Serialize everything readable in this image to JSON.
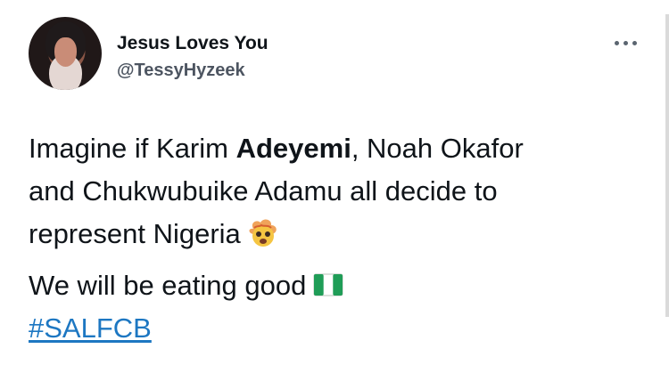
{
  "tweet": {
    "author": {
      "display_name": "Jesus Loves You",
      "handle": "@TessyHyzeek"
    },
    "body": {
      "line1_prefix": "Imagine if Karim ",
      "line1_bold": "Adeyemi",
      "line1_suffix": ", Noah Okafor",
      "line2": "and Chukwubuike Adamu all decide to",
      "line3": "represent Nigeria",
      "line4": "We will be eating good",
      "hashtag": "#SALFCB"
    },
    "icons": {
      "more": "more-options-icon",
      "face_emoji": "exploding-head-emoji",
      "flag_emoji": "nigeria-flag-emoji"
    },
    "colors": {
      "text": "#0f1419",
      "secondary": "#4d5561",
      "link": "#1d77c2",
      "flag_green": "#1f9d57"
    }
  }
}
